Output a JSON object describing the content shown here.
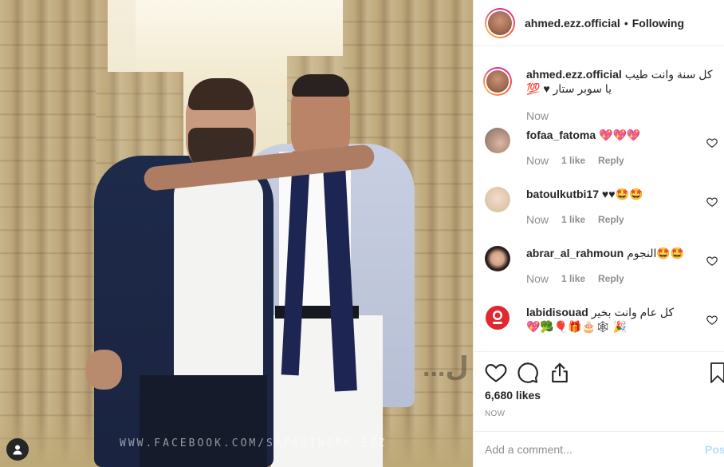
{
  "post": {
    "username": "ahmed.ezz.official",
    "separator": "•",
    "follow_status": "Following"
  },
  "photo": {
    "watermark": "WWW.FACEBOOK.COM/SAFADIWORK.EZZ",
    "corner_mark": "...ل"
  },
  "caption": {
    "username": "ahmed.ezz.official",
    "text": "كل سنة وانت طيب يا سوبر ستار ♥ 💯",
    "time": "Now"
  },
  "comments": [
    {
      "username": "fofaa_fatoma",
      "text": "💖💖💖",
      "time": "Now",
      "likes": "1 like",
      "reply": "Reply",
      "avatar": "woman-hand-avatar"
    },
    {
      "username": "batoulkutbi17",
      "text": "♥♥🤩🤩",
      "time": "Now",
      "likes": "1 like",
      "reply": "Reply",
      "avatar": "blonde-girl-avatar"
    },
    {
      "username": "abrar_al_rahmoun",
      "text": "النجوم🤩🤩",
      "time": "Now",
      "likes": "1 like",
      "reply": "Reply",
      "avatar": "hijab-woman-avatar"
    },
    {
      "username": "labidisouad",
      "text": "كل عام وانت بخير 🎉 🕸🎂🎁🎈🥦💖",
      "time": "",
      "likes": "",
      "reply": "",
      "avatar": "red-logo-avatar"
    }
  ],
  "actions": {
    "likes": "6,680 likes",
    "timestamp": "NOW"
  },
  "add_comment": {
    "placeholder": "Add a comment...",
    "post_label": "Post"
  },
  "colors": {
    "text": "#262626",
    "secondary": "#8e8e8e",
    "post_button": "#b2dffc",
    "border": "#efefef"
  }
}
